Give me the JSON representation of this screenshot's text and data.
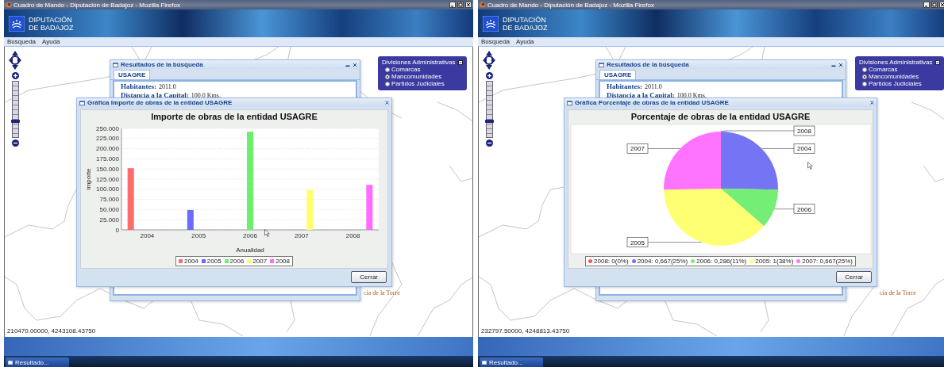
{
  "screens": [
    {
      "window": {
        "title": "Cuadro de Mando - Diputación de Badajoz - Mozilla Firefox"
      },
      "logo_lines": [
        "DIPUTACIÓN",
        "DE BADAJOZ"
      ],
      "menu": [
        "Búsqueda",
        "Ayuda"
      ],
      "zoom": {
        "level": 0.3
      },
      "results": {
        "title": "Resultados de la búsqueda",
        "tabs": [
          {
            "label": "USAGRE",
            "selected": true
          }
        ],
        "fields": [
          {
            "label": "Habitantes:",
            "value": "2011.0"
          },
          {
            "label": "Distancia a la Capital:",
            "value": "100.0 Kms."
          }
        ]
      },
      "divisions": {
        "title": "Divisiones Administrativas",
        "options": [
          {
            "label": "Comarcas",
            "selected": false
          },
          {
            "label": "Mancomunidades",
            "selected": true
          },
          {
            "label": "Partidos Judiciales",
            "selected": false
          }
        ]
      },
      "chart_window": {
        "title": "Gráfica Importe de obras de la entidad USAGRE",
        "chart_data": {
          "type": "bar",
          "title": "Importe de obras de la entidad USAGRE",
          "xlabel": "Anualidad",
          "ylabel": "Importe",
          "categories": [
            "2004",
            "2005",
            "2006",
            "2007",
            "2008"
          ],
          "series": [
            {
              "name": "2004",
              "color": "#ff6b6b",
              "values": [
                152,
                null,
                null,
                null,
                null
              ]
            },
            {
              "name": "2005",
              "color": "#6b6bff",
              "values": [
                null,
                49,
                null,
                null,
                null
              ]
            },
            {
              "name": "2006",
              "color": "#6bf06b",
              "values": [
                null,
                null,
                242,
                null,
                null
              ]
            },
            {
              "name": "2007",
              "color": "#ffff6b",
              "values": [
                null,
                null,
                null,
                98,
                null
              ]
            },
            {
              "name": "2008",
              "color": "#ff6bff",
              "values": [
                null,
                null,
                null,
                null,
                111
              ]
            }
          ],
          "ylim": [
            0,
            250
          ],
          "grid": true,
          "yticks": [
            {
              "value": 0,
              "label": "0"
            },
            {
              "value": 25,
              "label": "25.000"
            },
            {
              "value": 50,
              "label": "50.000"
            },
            {
              "value": 75,
              "label": "75.000"
            },
            {
              "value": 100,
              "label": "100.000"
            },
            {
              "value": 125,
              "label": "125.000"
            },
            {
              "value": 150,
              "label": "150.000"
            },
            {
              "value": 175,
              "label": "175.000"
            },
            {
              "value": 200,
              "label": "200.000"
            },
            {
              "value": 225,
              "label": "225.000"
            },
            {
              "value": 250,
              "label": "250.000"
            }
          ]
        },
        "button": "Cerrar"
      },
      "map_labels": [
        "cía de la Torre"
      ],
      "coordinates": "210470.00000, 4243108.43750",
      "taskbar": {
        "items": [
          "Resultado..."
        ]
      }
    },
    {
      "window": {
        "title": "Cuadro de Mando - Diputación de Badajoz - Mozilla Firefox"
      },
      "logo_lines": [
        "DIPUTACIÓN",
        "DE BADAJOZ"
      ],
      "menu": [
        "Búsqueda",
        "Ayuda"
      ],
      "zoom": {
        "level": 0.3
      },
      "results": {
        "title": "Resultados de la búsqueda",
        "tabs": [
          {
            "label": "USAGRE",
            "selected": true
          }
        ],
        "fields": [
          {
            "label": "Habitantes:",
            "value": "2011.0"
          },
          {
            "label": "Distancia a la Capital:",
            "value": "100.0 Kms."
          }
        ]
      },
      "divisions": {
        "title": "Divisiones Administrativas",
        "options": [
          {
            "label": "Comarcas",
            "selected": false
          },
          {
            "label": "Mancomunidades",
            "selected": true
          },
          {
            "label": "Partidos Judiciales",
            "selected": false
          }
        ]
      },
      "chart_window": {
        "title": "Gráfica Porcentaje de obras de la entidad USAGRE",
        "chart_data": {
          "type": "pie",
          "title": "Porcentaje de obras de la entidad USAGRE",
          "categories": [
            "2008",
            "2004",
            "2006",
            "2005",
            "2007"
          ],
          "values": [
            0,
            25,
            11,
            38,
            25
          ]
        },
        "legend": [
          {
            "label": "2008: 0(0%)",
            "color": "#ff5555"
          },
          {
            "label": "2004: 0,667(25%)",
            "color": "#7474f4"
          },
          {
            "label": "2006: 0,286(11%)",
            "color": "#74ee74"
          },
          {
            "label": "2005: 1(38%)",
            "color": "#ffff74"
          },
          {
            "label": "2007: 0,667(25%)",
            "color": "#ff74ff"
          }
        ],
        "button": "Cerrar"
      },
      "map_labels": [
        "cía de la Torre"
      ],
      "coordinates": "232797.50000, 4248813.43750",
      "taskbar": {
        "items": [
          "Resultado..."
        ]
      }
    }
  ]
}
